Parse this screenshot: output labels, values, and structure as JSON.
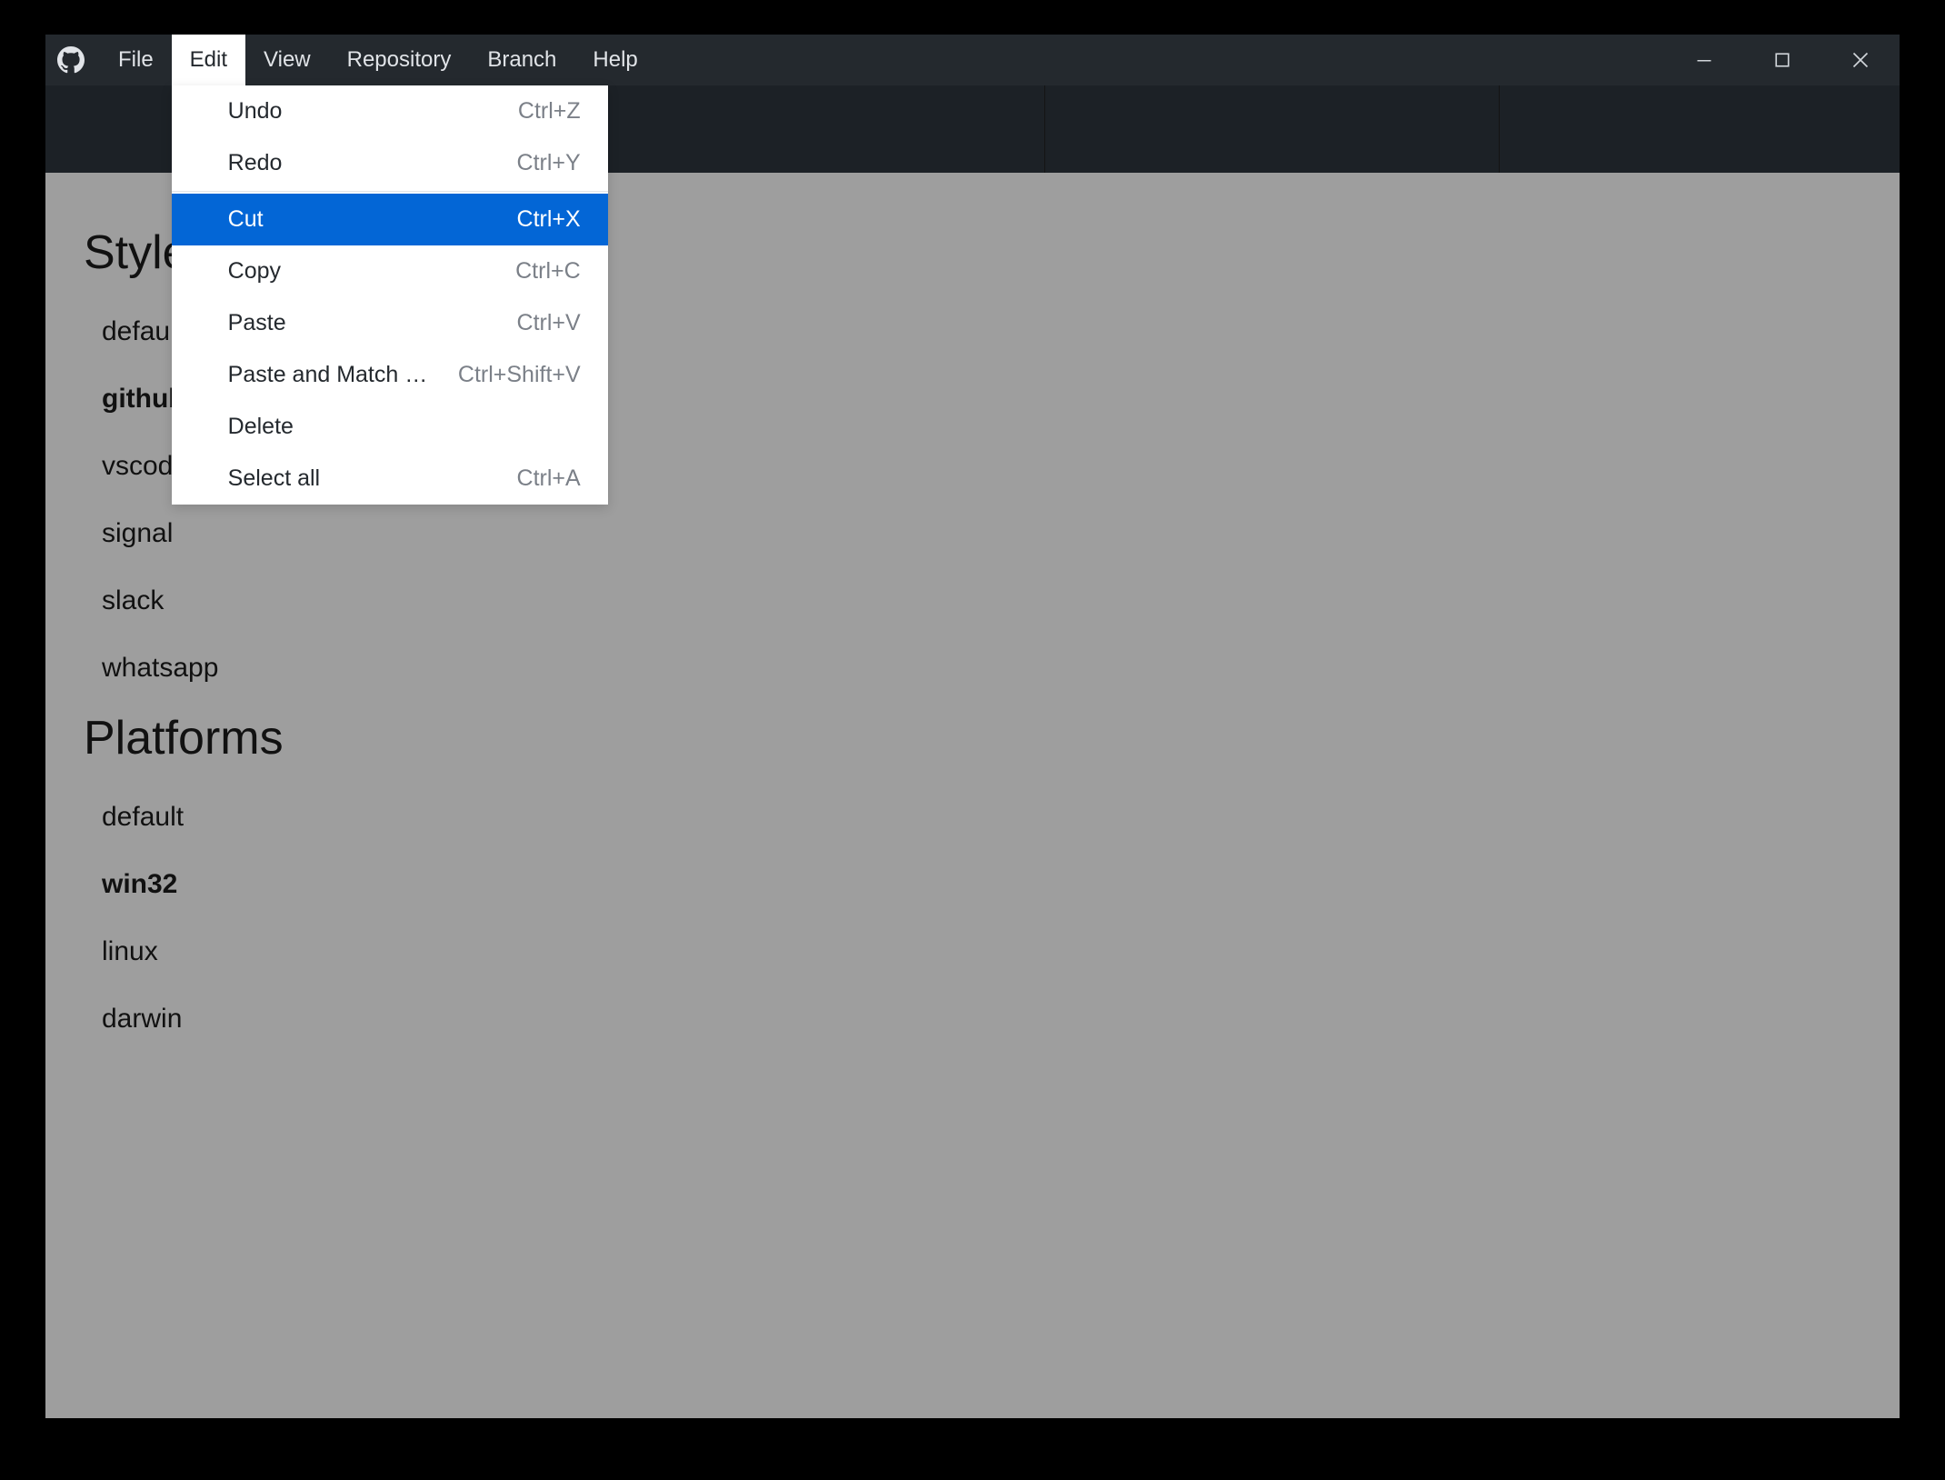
{
  "menubar": {
    "items": [
      {
        "label": "File"
      },
      {
        "label": "Edit"
      },
      {
        "label": "View"
      },
      {
        "label": "Repository"
      },
      {
        "label": "Branch"
      },
      {
        "label": "Help"
      }
    ],
    "active_index": 1
  },
  "edit_menu": {
    "groups": [
      [
        {
          "label": "Undo",
          "shortcut": "Ctrl+Z"
        },
        {
          "label": "Redo",
          "shortcut": "Ctrl+Y"
        }
      ],
      [
        {
          "label": "Cut",
          "shortcut": "Ctrl+X",
          "highlighted": true
        },
        {
          "label": "Copy",
          "shortcut": "Ctrl+C"
        },
        {
          "label": "Paste",
          "shortcut": "Ctrl+V"
        },
        {
          "label": "Paste and Match …",
          "shortcut": "Ctrl+Shift+V"
        },
        {
          "label": "Delete",
          "shortcut": ""
        },
        {
          "label": "Select all",
          "shortcut": "Ctrl+A"
        }
      ]
    ]
  },
  "content": {
    "sections": [
      {
        "heading": "Styles",
        "items": [
          {
            "label": "default"
          },
          {
            "label": "github",
            "bold": true
          },
          {
            "label": "vscode"
          },
          {
            "label": "signal"
          },
          {
            "label": "slack"
          },
          {
            "label": "whatsapp"
          }
        ]
      },
      {
        "heading": "Platforms",
        "items": [
          {
            "label": "default"
          },
          {
            "label": "win32",
            "bold": true
          },
          {
            "label": "linux"
          },
          {
            "label": "darwin"
          }
        ]
      }
    ]
  }
}
